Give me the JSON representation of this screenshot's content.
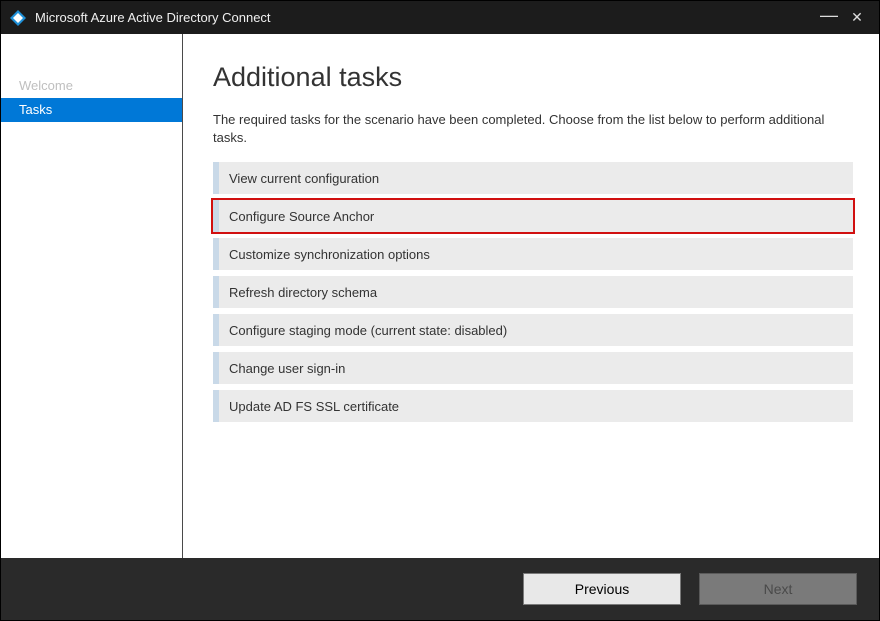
{
  "window": {
    "title": "Microsoft Azure Active Directory Connect"
  },
  "sidebar": {
    "items": [
      {
        "label": "Welcome",
        "active": false
      },
      {
        "label": "Tasks",
        "active": true
      }
    ]
  },
  "main": {
    "title": "Additional tasks",
    "intro": "The required tasks for the scenario have been completed. Choose from the list below to perform additional tasks.",
    "tasks": [
      {
        "label": "View current configuration"
      },
      {
        "label": "Configure Source Anchor",
        "highlighted": true
      },
      {
        "label": "Customize synchronization options"
      },
      {
        "label": "Refresh directory schema"
      },
      {
        "label": "Configure staging mode (current state: disabled)"
      },
      {
        "label": "Change user sign-in"
      },
      {
        "label": "Update AD FS SSL certificate"
      }
    ]
  },
  "footer": {
    "previous": "Previous",
    "next": "Next"
  }
}
